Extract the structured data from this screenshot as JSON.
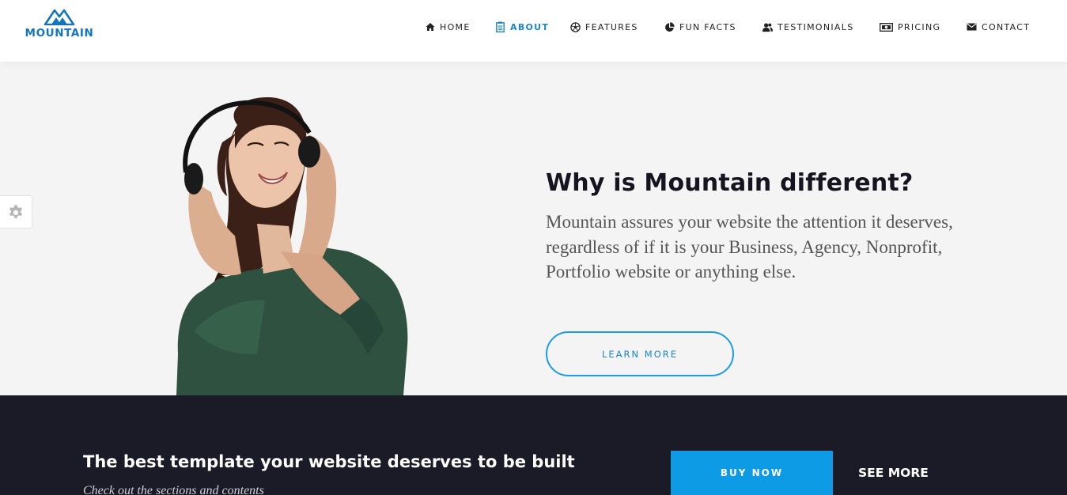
{
  "brand": {
    "name": "MOUNTAIN",
    "color": "#1276be"
  },
  "nav": {
    "items": [
      {
        "label": "HOME",
        "icon": "home-icon",
        "active": false
      },
      {
        "label": "ABOUT",
        "icon": "clipboard-icon",
        "active": true
      },
      {
        "label": "FEATURES",
        "icon": "soccer-ball-icon",
        "active": false
      },
      {
        "label": "FUN FACTS",
        "icon": "pie-chart-icon",
        "active": false
      },
      {
        "label": "TESTIMONIALS",
        "icon": "users-icon",
        "active": false
      },
      {
        "label": "PRICING",
        "icon": "money-icon",
        "active": false
      },
      {
        "label": "CONTACT",
        "icon": "envelope-icon",
        "active": false
      }
    ],
    "active_color": "#1c86c9"
  },
  "hero": {
    "title": "Why is Mountain different?",
    "text": "Mountain assures your website the attention it deserves, regardless of if it is your Business, Agency, Nonprofit, Portfolio website or anything else.",
    "button_label": "LEARN MORE",
    "image": "woman-with-headphones-photo"
  },
  "settings": {
    "icon": "gear-icon"
  },
  "band": {
    "title": "The best template your website deserves to be built",
    "subtitle": "Check out the sections and contents",
    "buy_label": "BUY NOW",
    "see_more_label": "SEE MORE",
    "accent": "#0e9be6",
    "background": "#1b1a27"
  }
}
